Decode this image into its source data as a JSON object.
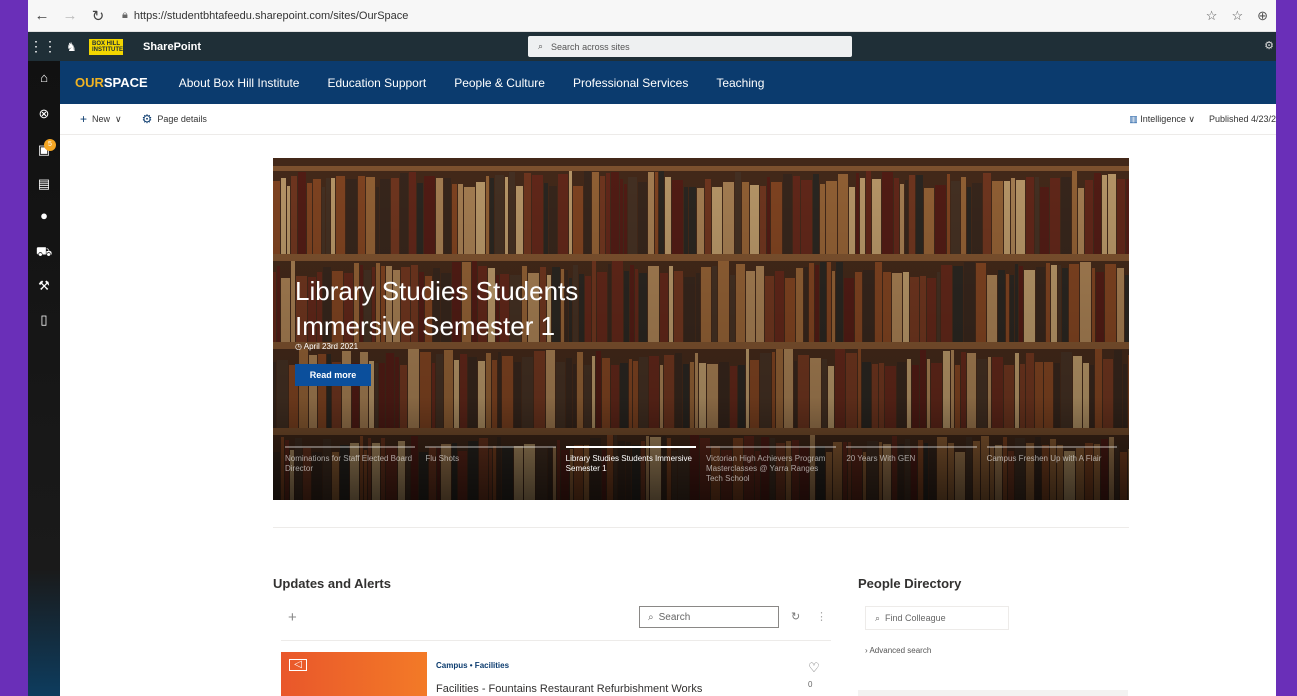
{
  "browser": {
    "back": "←",
    "forward": "→",
    "reload": "↻",
    "url": "https://studentbhtafeedu.sharepoint.com/sites/OurSpace"
  },
  "suite": {
    "logo_text": "BOX HILL INSTITUTE",
    "app_name": "SharePoint",
    "search_placeholder": "Search across sites"
  },
  "app_bar": {
    "badge_count": "5"
  },
  "site_nav": {
    "brand_a": "OUR",
    "brand_b": "SPACE",
    "items": [
      "About Box Hill Institute",
      "Education Support",
      "People & Culture",
      "Professional Services",
      "Teaching"
    ]
  },
  "command_bar": {
    "new_label": "New",
    "page_details_label": "Page details",
    "intelligence_label": "Intelligence",
    "published_label": "Published 4/23/2"
  },
  "hero": {
    "title": "Library Studies Students Immersive Semester 1",
    "date": "April 23rd 2021",
    "button": "Read more",
    "carousel": [
      "Nominations for Staff Elected Board Director",
      "Flu Shots",
      "Library Studies Students Immersive Semester 1",
      "Victorian High Achievers Program Masterclasses @ Yarra Ranges Tech School",
      "20 Years With GEN",
      "Campus Freshen Up with A Flair"
    ],
    "active_index": 2
  },
  "updates": {
    "title": "Updates and Alerts",
    "search_placeholder": "Search",
    "card": {
      "tags": "Campus • Facilities",
      "title": "Facilities - Fountains Restaurant Refurbishment Works",
      "likes": "0"
    }
  },
  "people": {
    "title": "People Directory",
    "search_placeholder": "Find Colleague",
    "advanced": "Advanced search"
  },
  "colors": {
    "suite_bar": "#1f2f37",
    "site_nav": "#0b3b6e",
    "brand_accent": "#f0b323",
    "card_orange": "#e9572b",
    "background_purple": "#6a2fb8"
  }
}
